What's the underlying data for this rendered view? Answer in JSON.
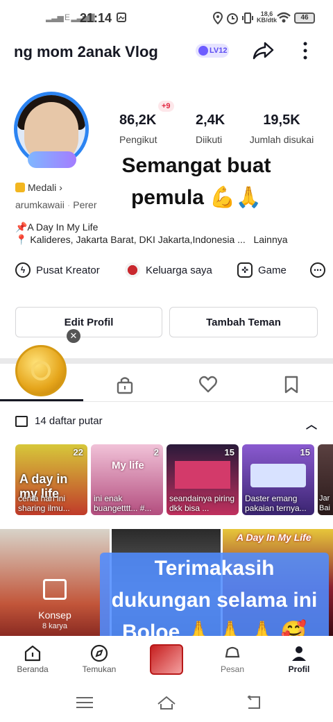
{
  "status_bar": {
    "time": "21:14",
    "signal": "E",
    "net_speed": "18,6",
    "net_unit": "KB/dtk",
    "battery": "46"
  },
  "header": {
    "name": "ng mom 2anak Vlog",
    "level": "LV12"
  },
  "stats": [
    {
      "value": "86,2K",
      "label": "Pengikut"
    },
    {
      "value": "2,4K",
      "label": "Diikuti"
    },
    {
      "value": "19,5K",
      "label": "Jumlah disukai"
    }
  ],
  "plus_badge": "+9",
  "overlay_top": {
    "line1": "Semangat buat",
    "line2": "pemula 💪🙏"
  },
  "medal": "Medali",
  "username": "arumkawaii",
  "username_suffix": "Perer",
  "bio": {
    "line1": "📌A Day In My Life",
    "line2": "📍 Kalideres, Jakarta Barat, DKI Jakarta,Indonesia ...",
    "more": "Lainnya"
  },
  "quick_links": [
    {
      "label": "Pusat Kreator",
      "icon": "bolt-icon"
    },
    {
      "label": "Keluarga saya",
      "icon": "family-icon"
    },
    {
      "label": "Game",
      "icon": "gamepad-icon"
    }
  ],
  "buttons": {
    "edit": "Edit Profil",
    "add_friend": "Tambah Teman"
  },
  "playlists": {
    "header": "14 daftar putar",
    "items": [
      {
        "count": "22",
        "title": "cerita hari ini sharing ilmu...",
        "thumb_text": "A day in my life",
        "bg": "#d9c83a"
      },
      {
        "count": "2",
        "title": "ini enak buangetttt... #...",
        "thumb_text": "My life",
        "bg": "#e7a3c4"
      },
      {
        "count": "15",
        "title": "seandainya piring dkk bisa ...",
        "thumb_text": "",
        "bg": "#b02a5a"
      },
      {
        "count": "15",
        "title": "Daster emang pakaian ternya...",
        "thumb_text": "",
        "bg": "#6a3fb0"
      },
      {
        "count": "",
        "title": "Jar Bai",
        "thumb_text": "",
        "bg": "#3a2a2a"
      }
    ]
  },
  "grid": {
    "konsep_label": "Konsep",
    "konsep_count": "8 karya",
    "thumb3_text": "A Day In My Life"
  },
  "overlay_bottom": {
    "line1": "Terimakasih",
    "line2": "dukungan selama ini",
    "line3": "Boloe 🙏 🙏 🙏 🥰"
  },
  "bottom_nav": [
    {
      "label": "Beranda"
    },
    {
      "label": "Temukan"
    },
    {
      "label": "Pesan"
    },
    {
      "label": "Profil"
    }
  ]
}
